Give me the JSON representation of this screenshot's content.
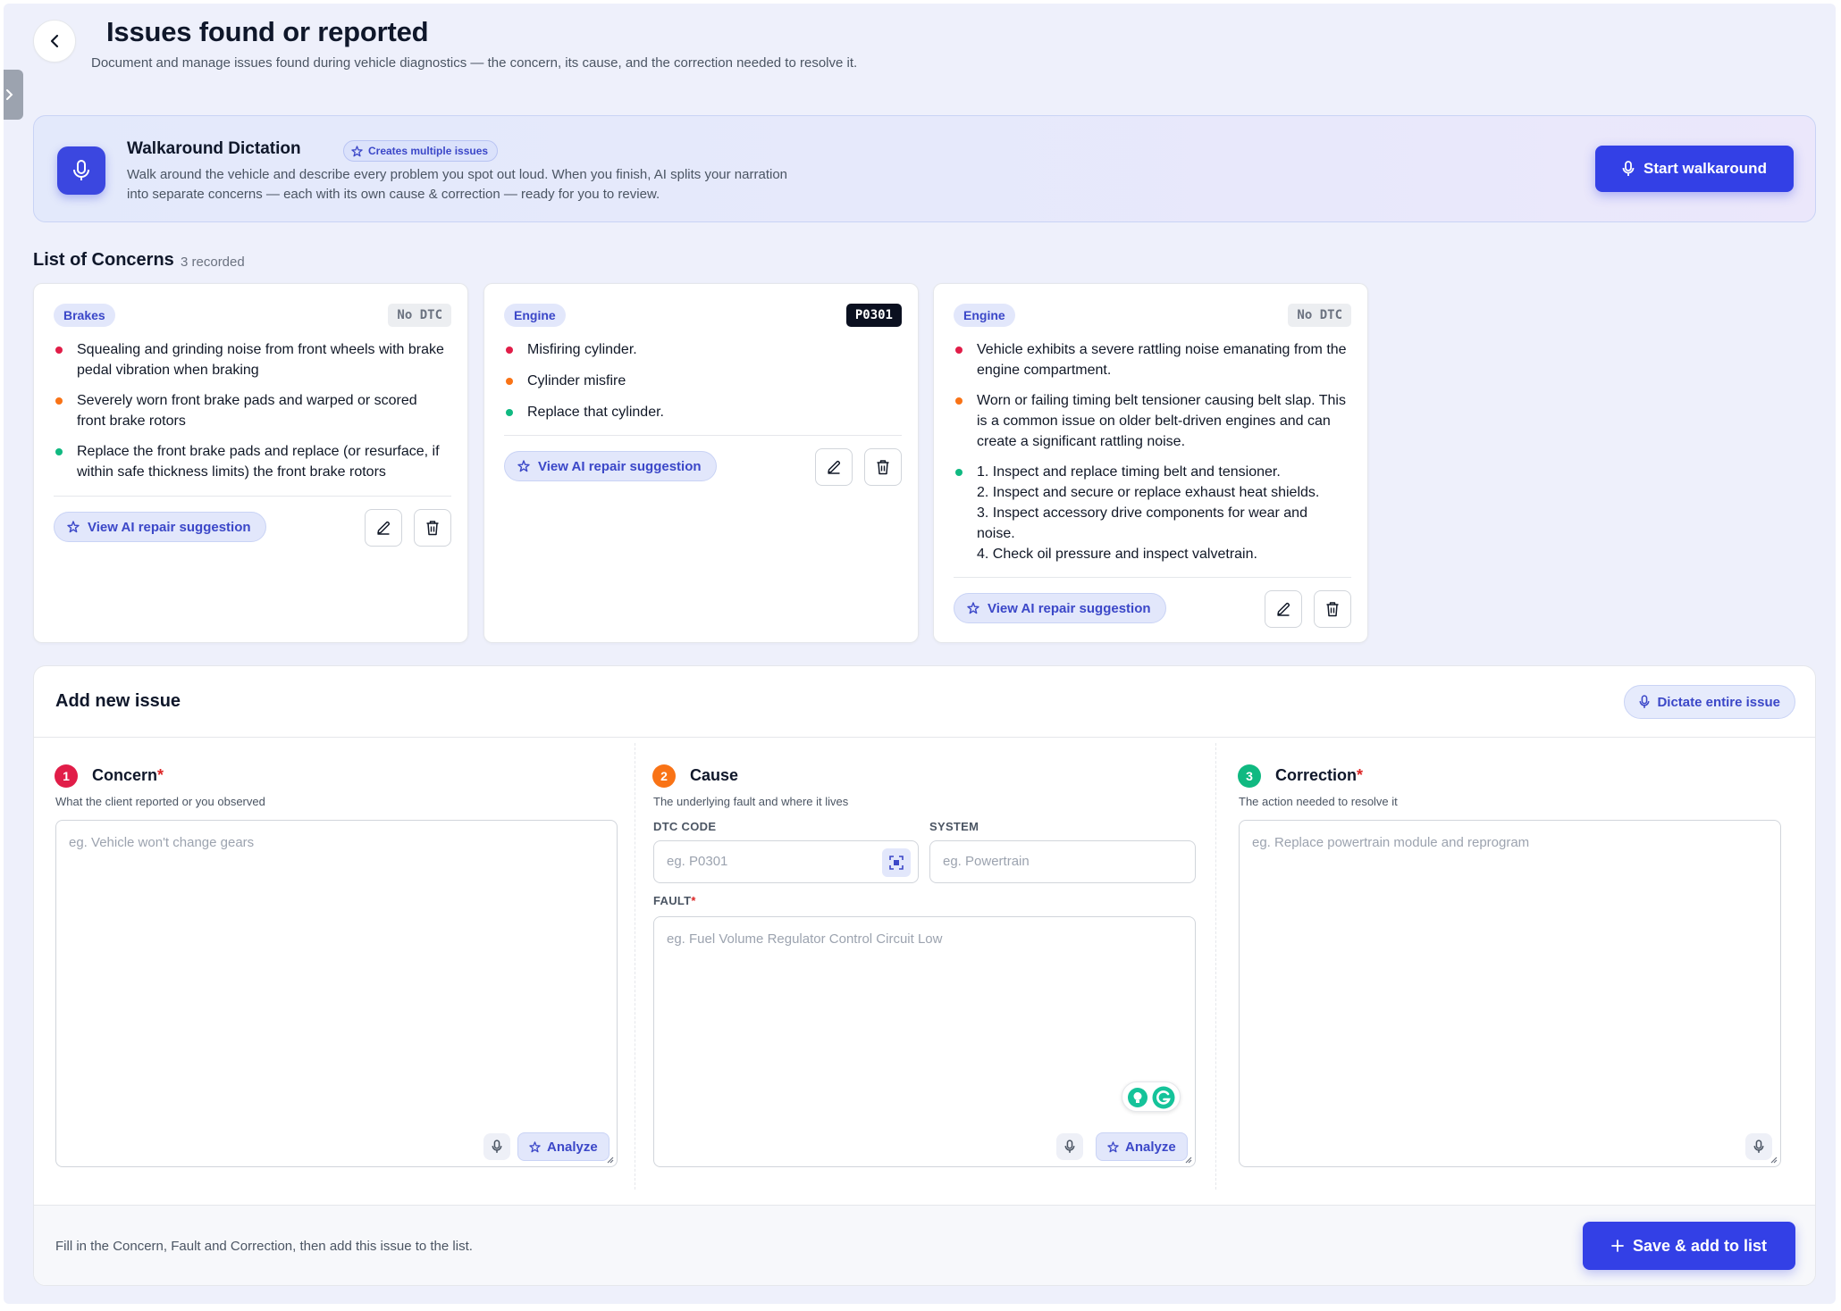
{
  "header": {
    "title": "Issues found or reported",
    "subtitle": "Document and manage issues found during vehicle diagnostics — the concern, its cause, and the correction needed to resolve it."
  },
  "walkaround": {
    "title": "Walkaround Dictation",
    "badge": "Creates multiple issues",
    "description": "Walk around the vehicle and describe every problem you spot out loud. When you finish, AI splits your narration into separate concerns — each with its own cause & correction — ready for you to review.",
    "button": "Start walkaround"
  },
  "concerns": {
    "title": "List of Concerns",
    "count": "3 recorded",
    "ai_label": "View AI repair suggestion",
    "cards": [
      {
        "system": "Brakes",
        "dtc": "No DTC",
        "concern": "Squealing and grinding noise from front wheels with brake pedal vibration when braking",
        "cause": "Severely worn front brake pads and warped or scored front brake rotors",
        "correction": "Replace the front brake pads and replace (or resurface, if within safe thickness limits) the front brake rotors"
      },
      {
        "system": "Engine",
        "dtc": "P0301",
        "concern": "Misfiring cylinder.",
        "cause": "Cylinder misfire",
        "correction": "Replace that cylinder."
      },
      {
        "system": "Engine",
        "dtc": "No DTC",
        "concern": "Vehicle exhibits a severe rattling noise emanating from the engine compartment.",
        "cause": "Worn or failing timing belt tensioner causing belt slap. This is a common issue on older belt-driven engines and can create a significant rattling noise.",
        "correction": "1. Inspect and replace timing belt and tensioner.\n2. Inspect and secure or replace exhaust heat shields.\n3. Inspect accessory drive components for wear and noise.\n4. Check oil pressure and inspect valvetrain."
      }
    ]
  },
  "add_issue": {
    "title": "Add new issue",
    "dictate_button": "Dictate entire issue",
    "analyze_label": "Analyze",
    "concern": {
      "number": "1",
      "title": "Concern",
      "required": "*",
      "subtitle": "What the client reported or you observed",
      "placeholder": "eg. Vehicle won't change gears"
    },
    "cause": {
      "number": "2",
      "title": "Cause",
      "subtitle": "The underlying fault and where it lives",
      "dtc_label": "DTC CODE",
      "dtc_placeholder": "eg. P0301",
      "system_label": "SYSTEM",
      "system_placeholder": "eg. Powertrain",
      "fault_label": "FAULT",
      "fault_required": "*",
      "fault_placeholder": "eg. Fuel Volume Regulator Control Circuit Low"
    },
    "correction": {
      "number": "3",
      "title": "Correction",
      "required": "*",
      "subtitle": "The action needed to resolve it",
      "placeholder": "eg. Replace powertrain module and reprogram"
    },
    "footer_text": "Fill in the Concern, Fault and Correction, then add this issue to the list.",
    "save_button": "Save & add to list"
  },
  "colors": {
    "accent": "#3340e6",
    "concern_dot": "#e11d48",
    "cause_dot": "#f97316",
    "correction_dot": "#10b981",
    "grammarly": "#15c39a"
  }
}
